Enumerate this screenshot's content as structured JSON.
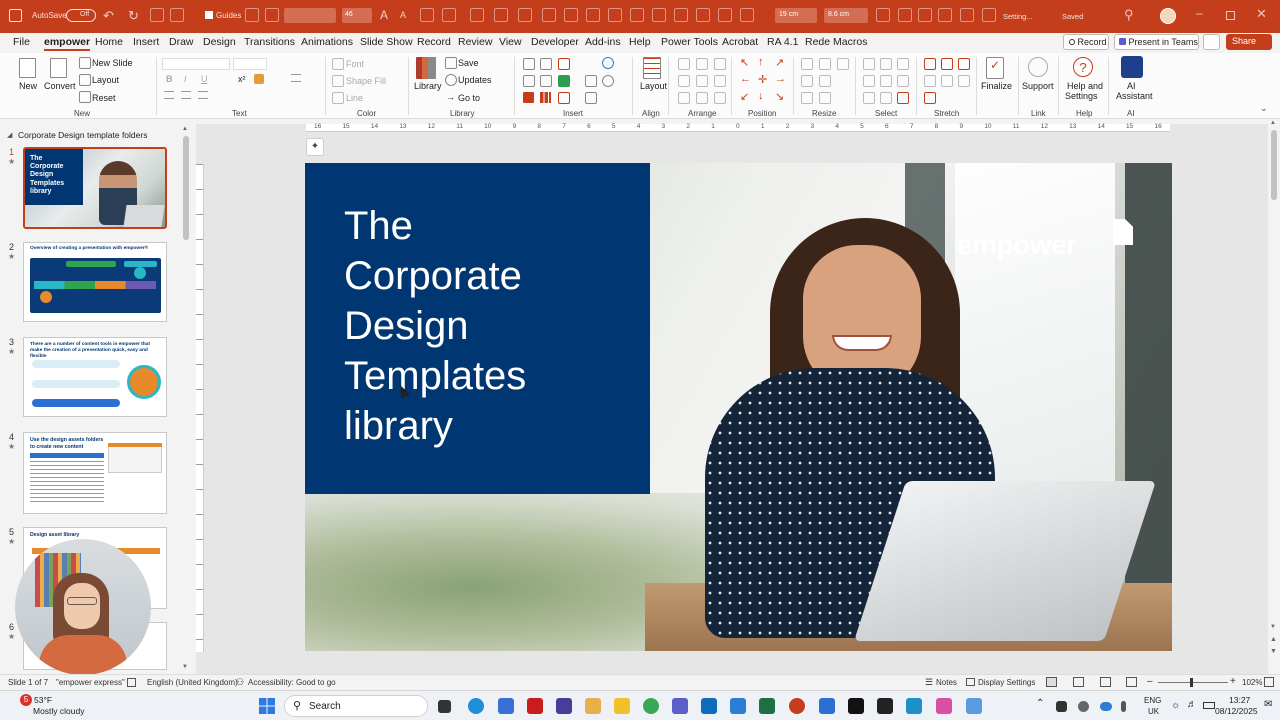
{
  "titlebar": {
    "autosave_label": "AutoSave",
    "autosave_state": "Off",
    "guides_label": "Guides",
    "font_size_box": "46",
    "width_box": "19 cm",
    "height_box": "8.6 cm",
    "status": "Setting...",
    "saved": "Saved"
  },
  "menu": {
    "tabs": [
      "File",
      "empower",
      "Home",
      "Insert",
      "Draw",
      "Design",
      "Transitions",
      "Animations",
      "Slide Show",
      "Record",
      "Review",
      "View",
      "Developer",
      "Add-ins",
      "Help",
      "Power Tools",
      "Acrobat",
      "RA 4.1",
      "Rede Macros"
    ],
    "active_tab": "empower",
    "record_button": "Record",
    "present_button": "Present in Teams",
    "share_button": "Share"
  },
  "ribbon": {
    "new": "New",
    "convert": "Convert",
    "new_slide": "New Slide",
    "layout": "Layout",
    "reset": "Reset",
    "group_new": "New",
    "group_text": "Text",
    "font": "Font",
    "shape_fill": "Shape Fill",
    "line": "Line",
    "group_color": "Color",
    "library": "Library",
    "save": "Save",
    "updates": "Updates",
    "go_to": "Go to",
    "group_library": "Library",
    "group_insert": "Insert",
    "layout_btn": "Layout",
    "group_align": "Align",
    "group_arrange": "Arrange",
    "group_position": "Position",
    "group_resize": "Resize",
    "group_select": "Select",
    "group_stretch": "Stretch",
    "finalize": "Finalize",
    "support": "Support",
    "help_settings_1": "Help and",
    "help_settings_2": "Settings",
    "ai_1": "AI",
    "ai_2": "Assistant",
    "group_link": "Link",
    "group_help": "Help",
    "group_ai": "AI"
  },
  "ruler": {
    "numbers": [
      "16",
      "15",
      "14",
      "13",
      "12",
      "11",
      "10",
      "9",
      "8",
      "7",
      "6",
      "5",
      "4",
      "3",
      "2",
      "1",
      "0",
      "1",
      "2",
      "3",
      "4",
      "5",
      "6",
      "7",
      "8",
      "9",
      "10",
      "11",
      "12",
      "13",
      "14",
      "15",
      "16"
    ]
  },
  "leftpane": {
    "section_title": "Corporate Design template folders",
    "slides": [
      {
        "num": "1",
        "title": "The Corporate Design Templates library"
      },
      {
        "num": "2",
        "title": "Overview of creating a presentation with empower®"
      },
      {
        "num": "3",
        "title": "There are a number of content tools in empower that make the creation of a presentation quick, easy and flexible"
      },
      {
        "num": "4",
        "title": "Use the design assets folders to create new content"
      },
      {
        "num": "5",
        "title": "Design asset library"
      },
      {
        "num": "6",
        "title": ""
      }
    ]
  },
  "slide": {
    "title_lines": [
      "The",
      "Corporate",
      "Design",
      "Templates",
      "library"
    ],
    "logo_text": "empower"
  },
  "statusbar": {
    "slide_count": "Slide 1 of 7",
    "theme": "\"empower express\"",
    "language": "English (United Kingdom)",
    "accessibility": "Accessibility: Good to go",
    "notes": "Notes",
    "display_settings": "Display Settings",
    "zoom": "102%"
  },
  "taskbar": {
    "temperature": "53°F",
    "weather": "Mostly cloudy",
    "search": "Search",
    "lang1": "ENG",
    "lang2": "UK",
    "time": "13:27",
    "date": "08/12/2025",
    "notification_count": "5"
  },
  "colors": {
    "accent": "#c43e1c",
    "slide_navy": "#003772",
    "taskbar_bg": "#eef1f5"
  }
}
